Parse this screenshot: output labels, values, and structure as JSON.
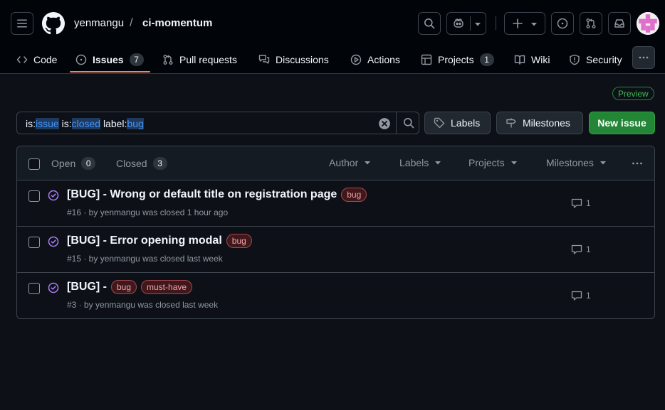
{
  "header": {
    "owner": "yenmangu",
    "separator": "/",
    "repo": "ci-momentum"
  },
  "tabs": [
    {
      "label": "Code",
      "icon": "code-icon"
    },
    {
      "label": "Issues",
      "icon": "issue-opened-icon",
      "count": "7"
    },
    {
      "label": "Pull requests",
      "icon": "git-pull-request-icon"
    },
    {
      "label": "Discussions",
      "icon": "comment-discussion-icon"
    },
    {
      "label": "Actions",
      "icon": "play-icon"
    },
    {
      "label": "Projects",
      "icon": "table-icon",
      "count": "1"
    },
    {
      "label": "Wiki",
      "icon": "book-icon"
    },
    {
      "label": "Security",
      "icon": "shield-icon"
    }
  ],
  "preview_badge": "Preview",
  "search": {
    "q1_key": "is:",
    "q1_val": "issue",
    "q2_key": "is:",
    "q2_val": "closed",
    "q3_key": "label:",
    "q3_val": "bug"
  },
  "buttons": {
    "labels": "Labels",
    "milestones": "Milestones",
    "new_issue": "New issue"
  },
  "list_header": {
    "open_label": "Open",
    "open_count": "0",
    "closed_label": "Closed",
    "closed_count": "3",
    "filters": [
      "Author",
      "Labels",
      "Projects",
      "Milestones"
    ]
  },
  "issues": [
    {
      "title": "[BUG] - Wrong or default title on registration page",
      "labels": [
        "bug"
      ],
      "meta": "#16 · by yenmangu was closed 1 hour ago",
      "comments": "1"
    },
    {
      "title": "[BUG] - Error opening modal",
      "labels": [
        "bug"
      ],
      "meta": "#15 · by yenmangu was closed last week",
      "comments": "1"
    },
    {
      "title": "[BUG] -",
      "labels": [
        "bug",
        "must-have"
      ],
      "meta": "#3 · by yenmangu was closed last week",
      "comments": "1"
    }
  ],
  "colors": {
    "background": "#0d1117",
    "accent_green": "#238636",
    "closed_purple": "#ab7df8",
    "tab_underline": "#f78166",
    "bug_label": "#f4a3a8"
  }
}
